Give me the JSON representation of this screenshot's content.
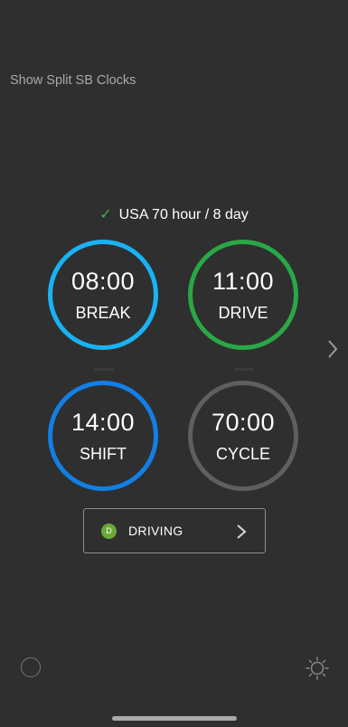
{
  "header": {
    "split_link": "Show Split SB Clocks"
  },
  "ruleset": {
    "label": "USA 70 hour / 8 day",
    "check_icon": "check-icon",
    "check_color": "#3fb24a"
  },
  "clocks": [
    {
      "time": "08:00",
      "label": "BREAK",
      "color": "#19b3f5"
    },
    {
      "time": "11:00",
      "label": "DRIVE",
      "color": "#29a846"
    },
    {
      "time": "14:00",
      "label": "SHIFT",
      "color": "#127fe5"
    },
    {
      "time": "70:00",
      "label": "CYCLE",
      "color": "#5f5f5f"
    }
  ],
  "status": {
    "badge": "D",
    "label": "DRIVING",
    "badge_color": "#6aa935"
  },
  "icons": {
    "next": "chevron-right-icon",
    "bottom_left": "circle-icon",
    "bottom_right": "sun-icon"
  }
}
